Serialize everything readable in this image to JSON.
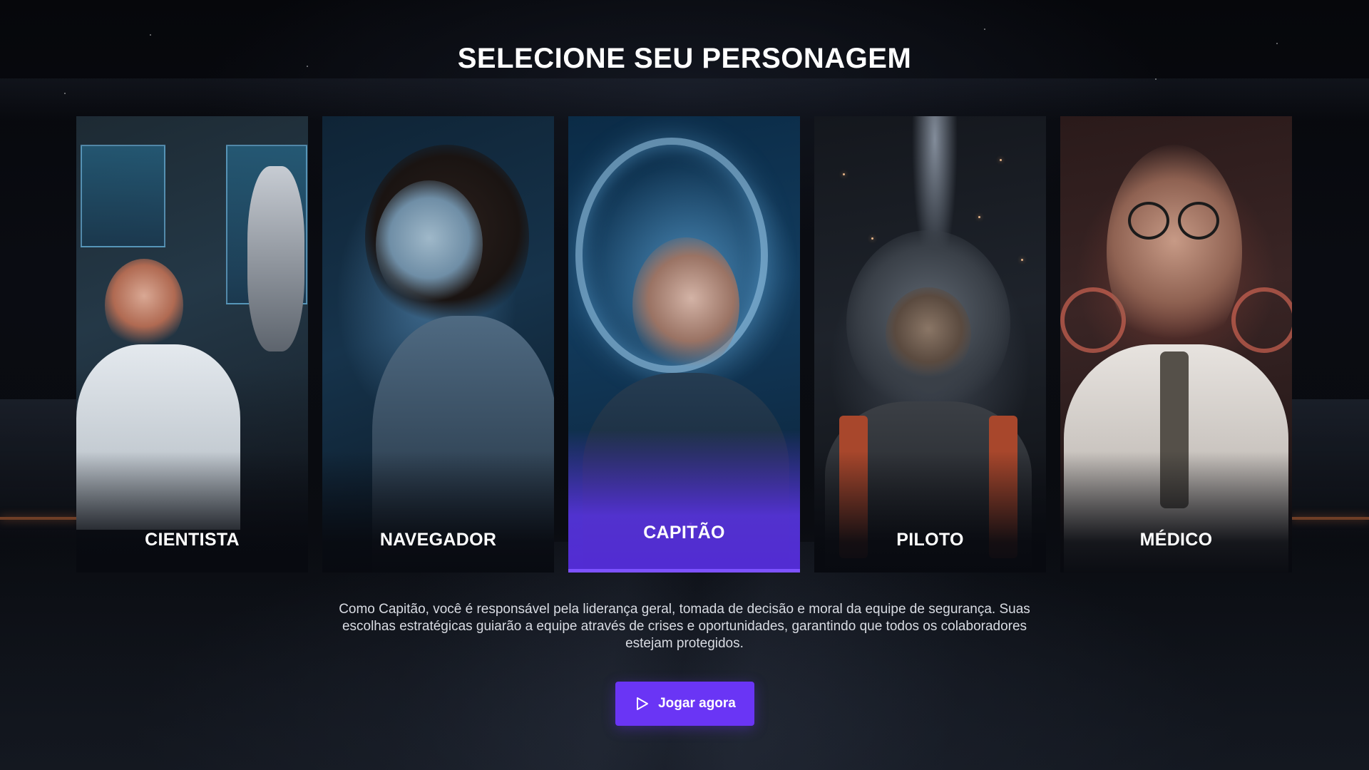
{
  "screen": {
    "title": "SELECIONE SEU PERSONAGEM"
  },
  "characters": [
    {
      "id": "cientista",
      "label": "CIENTISTA",
      "selected": false
    },
    {
      "id": "navegador",
      "label": "NAVEGADOR",
      "selected": false
    },
    {
      "id": "capitao",
      "label": "CAPITÃO",
      "selected": true
    },
    {
      "id": "piloto",
      "label": "PILOTO",
      "selected": false
    },
    {
      "id": "medico",
      "label": "MÉDICO",
      "selected": false
    }
  ],
  "selected_description": "Como Capitão, você é responsável pela liderança geral, tomada de decisão e moral da equipe de segurança. Suas escolhas estratégicas guiarão a equipe através de crises e oportunidades, garantindo que todos os colaboradores estejam protegidos.",
  "play_button": {
    "label": "Jogar agora",
    "icon": "play-icon"
  },
  "colors": {
    "accent": "#6a35f5",
    "selected_underline": "#7d52ff",
    "text": "#ffffff"
  }
}
